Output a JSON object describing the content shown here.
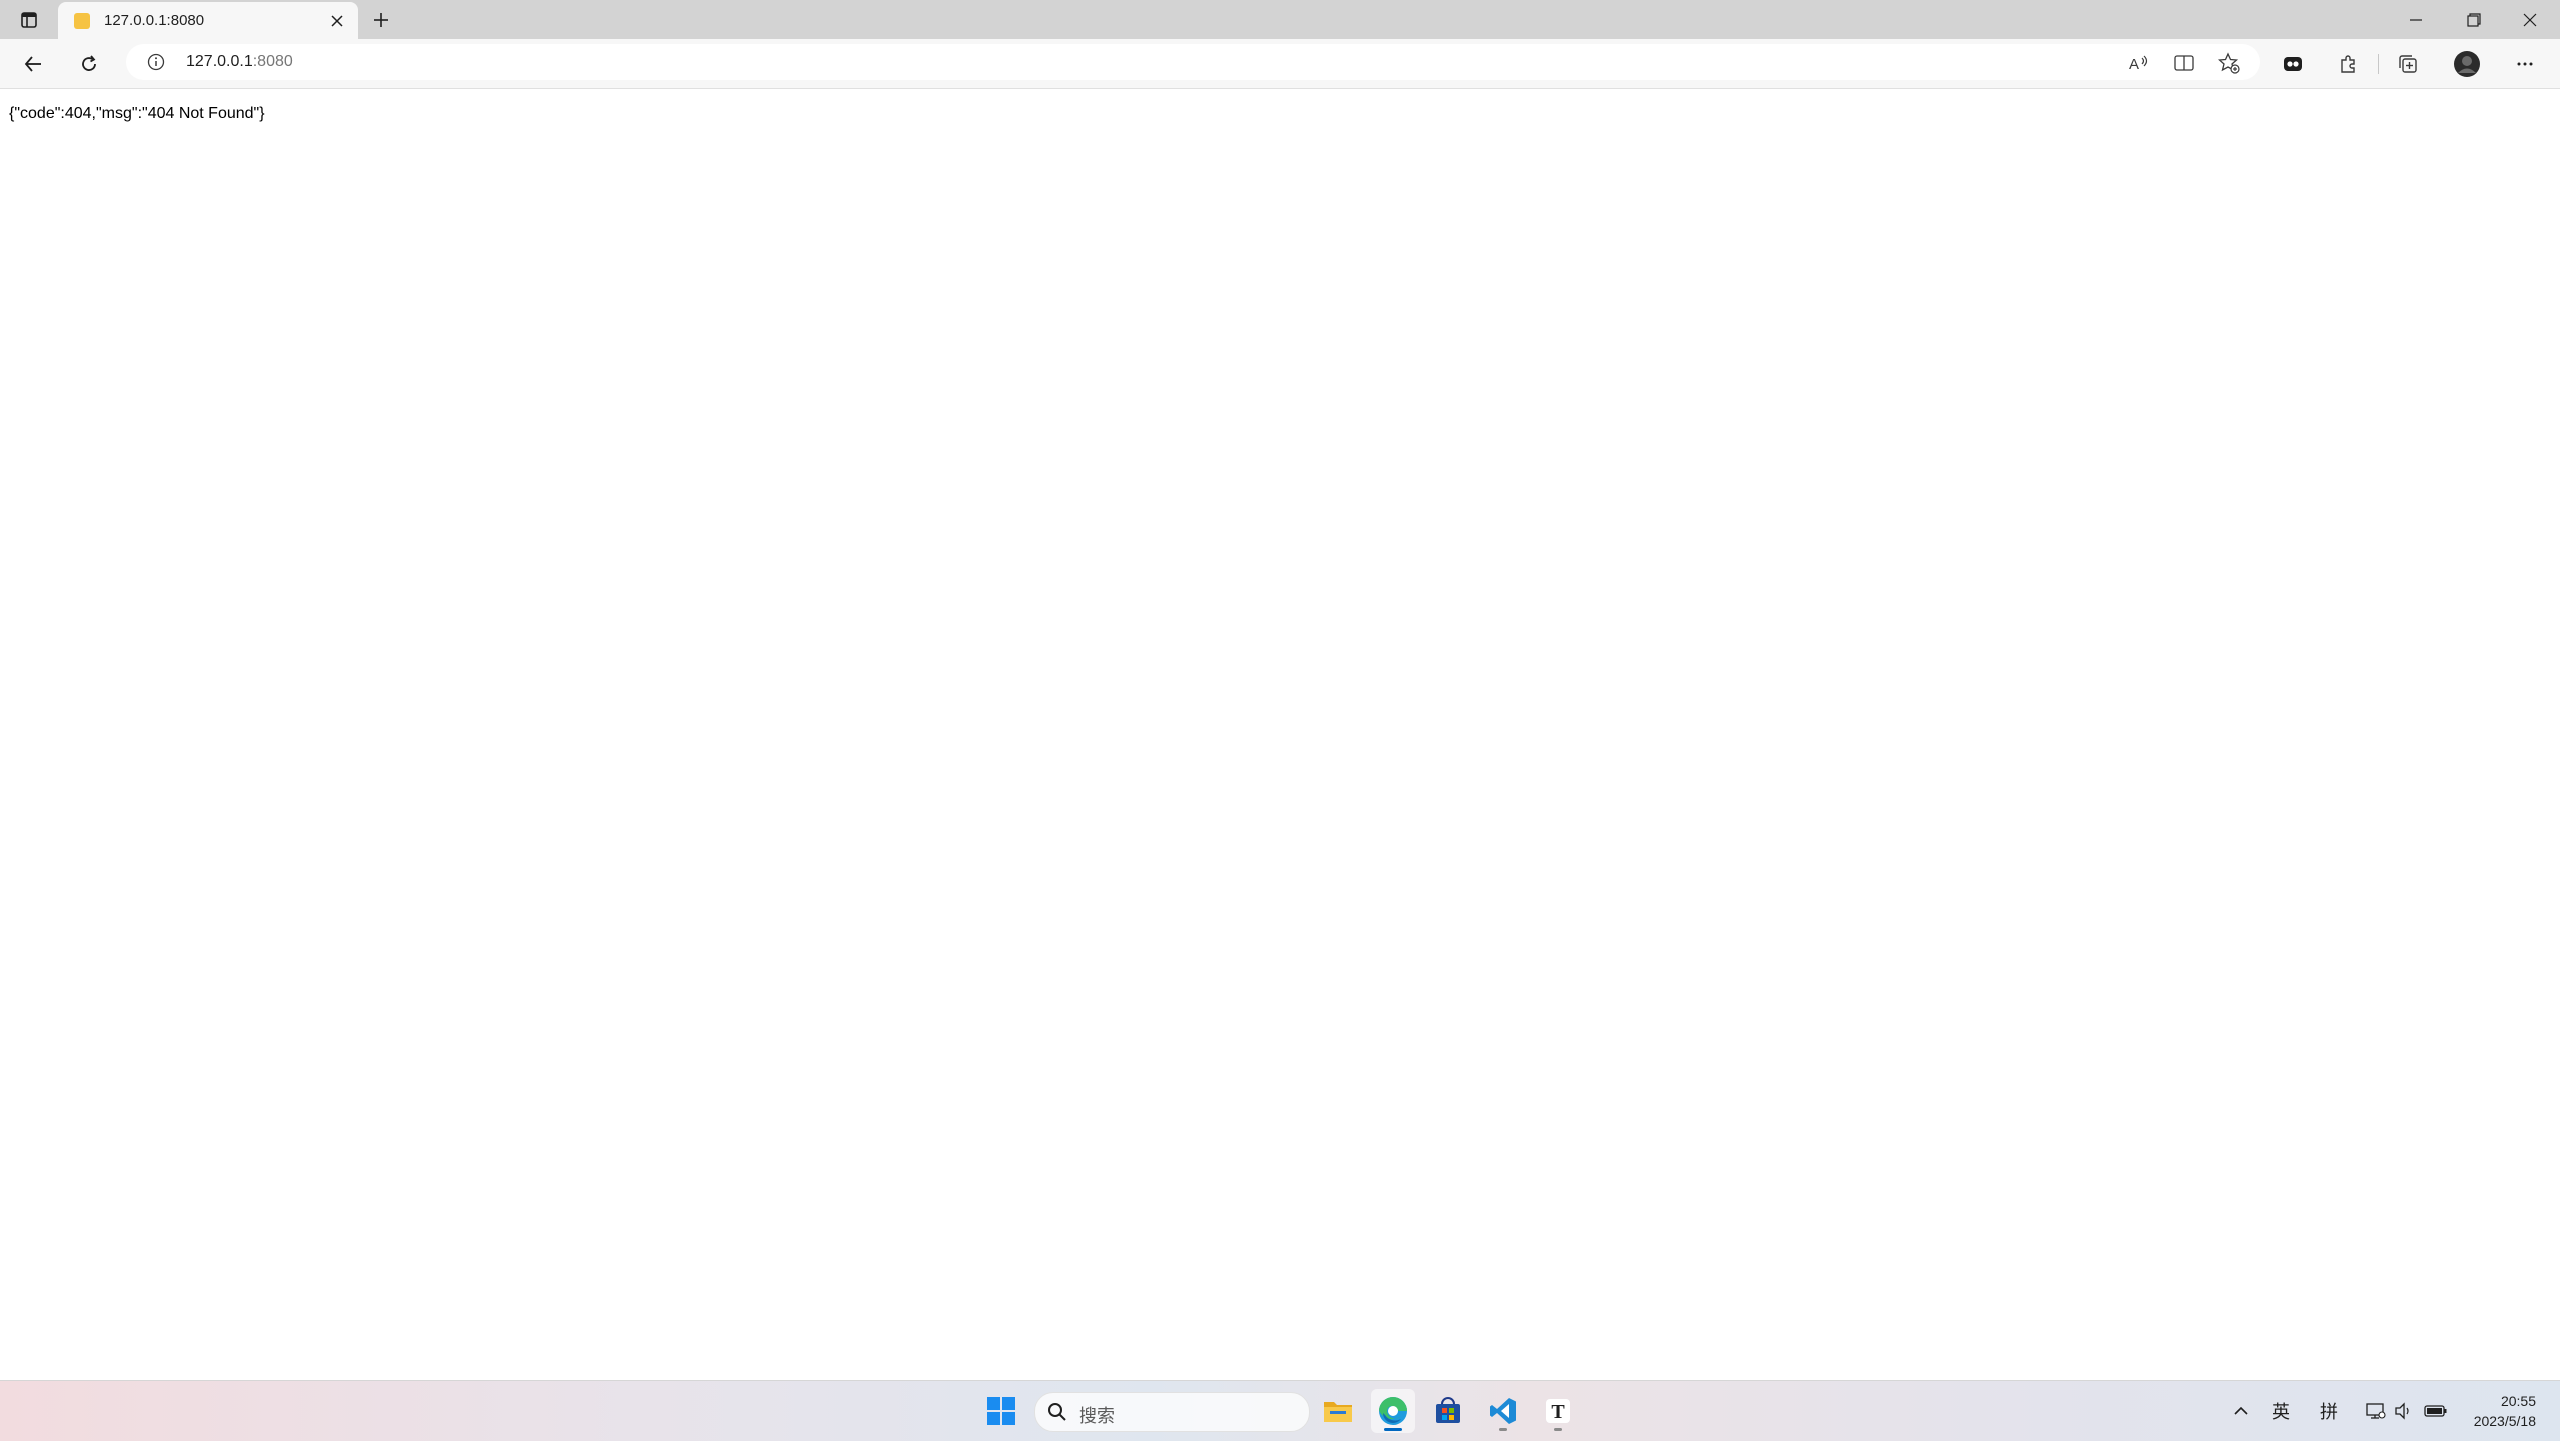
{
  "browser": {
    "tab": {
      "title": "127.0.0.1:8080"
    },
    "address": {
      "host": "127.0.0.1",
      "port": ":8080"
    }
  },
  "page": {
    "body_text": "{\"code\":404,\"msg\":\"404 Not Found\"}"
  },
  "taskbar": {
    "search_placeholder": "搜索",
    "apps": [
      "windows-start",
      "file-explorer",
      "edge",
      "microsoft-store",
      "vscode",
      "typora"
    ],
    "tray": {
      "language": "英",
      "ime": "拼"
    },
    "clock": {
      "time": "20:55",
      "date": "2023/5/18"
    }
  },
  "colors": {
    "accent": "#0067c0",
    "tab_favicon": "#f6c343"
  }
}
